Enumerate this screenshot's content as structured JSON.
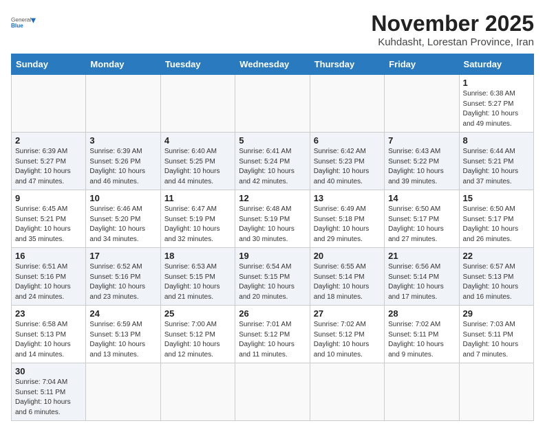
{
  "header": {
    "logo_line1": "General",
    "logo_line2": "Blue",
    "month_title": "November 2025",
    "location": "Kuhdasht, Lorestan Province, Iran"
  },
  "weekdays": [
    "Sunday",
    "Monday",
    "Tuesday",
    "Wednesday",
    "Thursday",
    "Friday",
    "Saturday"
  ],
  "weeks": [
    [
      {
        "day": "",
        "info": ""
      },
      {
        "day": "",
        "info": ""
      },
      {
        "day": "",
        "info": ""
      },
      {
        "day": "",
        "info": ""
      },
      {
        "day": "",
        "info": ""
      },
      {
        "day": "",
        "info": ""
      },
      {
        "day": "1",
        "info": "Sunrise: 6:38 AM\nSunset: 5:27 PM\nDaylight: 10 hours\nand 49 minutes."
      }
    ],
    [
      {
        "day": "2",
        "info": "Sunrise: 6:39 AM\nSunset: 5:27 PM\nDaylight: 10 hours\nand 47 minutes."
      },
      {
        "day": "3",
        "info": "Sunrise: 6:39 AM\nSunset: 5:26 PM\nDaylight: 10 hours\nand 46 minutes."
      },
      {
        "day": "4",
        "info": "Sunrise: 6:40 AM\nSunset: 5:25 PM\nDaylight: 10 hours\nand 44 minutes."
      },
      {
        "day": "5",
        "info": "Sunrise: 6:41 AM\nSunset: 5:24 PM\nDaylight: 10 hours\nand 42 minutes."
      },
      {
        "day": "6",
        "info": "Sunrise: 6:42 AM\nSunset: 5:23 PM\nDaylight: 10 hours\nand 40 minutes."
      },
      {
        "day": "7",
        "info": "Sunrise: 6:43 AM\nSunset: 5:22 PM\nDaylight: 10 hours\nand 39 minutes."
      },
      {
        "day": "8",
        "info": "Sunrise: 6:44 AM\nSunset: 5:21 PM\nDaylight: 10 hours\nand 37 minutes."
      }
    ],
    [
      {
        "day": "9",
        "info": "Sunrise: 6:45 AM\nSunset: 5:21 PM\nDaylight: 10 hours\nand 35 minutes."
      },
      {
        "day": "10",
        "info": "Sunrise: 6:46 AM\nSunset: 5:20 PM\nDaylight: 10 hours\nand 34 minutes."
      },
      {
        "day": "11",
        "info": "Sunrise: 6:47 AM\nSunset: 5:19 PM\nDaylight: 10 hours\nand 32 minutes."
      },
      {
        "day": "12",
        "info": "Sunrise: 6:48 AM\nSunset: 5:19 PM\nDaylight: 10 hours\nand 30 minutes."
      },
      {
        "day": "13",
        "info": "Sunrise: 6:49 AM\nSunset: 5:18 PM\nDaylight: 10 hours\nand 29 minutes."
      },
      {
        "day": "14",
        "info": "Sunrise: 6:50 AM\nSunset: 5:17 PM\nDaylight: 10 hours\nand 27 minutes."
      },
      {
        "day": "15",
        "info": "Sunrise: 6:50 AM\nSunset: 5:17 PM\nDaylight: 10 hours\nand 26 minutes."
      }
    ],
    [
      {
        "day": "16",
        "info": "Sunrise: 6:51 AM\nSunset: 5:16 PM\nDaylight: 10 hours\nand 24 minutes."
      },
      {
        "day": "17",
        "info": "Sunrise: 6:52 AM\nSunset: 5:16 PM\nDaylight: 10 hours\nand 23 minutes."
      },
      {
        "day": "18",
        "info": "Sunrise: 6:53 AM\nSunset: 5:15 PM\nDaylight: 10 hours\nand 21 minutes."
      },
      {
        "day": "19",
        "info": "Sunrise: 6:54 AM\nSunset: 5:15 PM\nDaylight: 10 hours\nand 20 minutes."
      },
      {
        "day": "20",
        "info": "Sunrise: 6:55 AM\nSunset: 5:14 PM\nDaylight: 10 hours\nand 18 minutes."
      },
      {
        "day": "21",
        "info": "Sunrise: 6:56 AM\nSunset: 5:14 PM\nDaylight: 10 hours\nand 17 minutes."
      },
      {
        "day": "22",
        "info": "Sunrise: 6:57 AM\nSunset: 5:13 PM\nDaylight: 10 hours\nand 16 minutes."
      }
    ],
    [
      {
        "day": "23",
        "info": "Sunrise: 6:58 AM\nSunset: 5:13 PM\nDaylight: 10 hours\nand 14 minutes."
      },
      {
        "day": "24",
        "info": "Sunrise: 6:59 AM\nSunset: 5:13 PM\nDaylight: 10 hours\nand 13 minutes."
      },
      {
        "day": "25",
        "info": "Sunrise: 7:00 AM\nSunset: 5:12 PM\nDaylight: 10 hours\nand 12 minutes."
      },
      {
        "day": "26",
        "info": "Sunrise: 7:01 AM\nSunset: 5:12 PM\nDaylight: 10 hours\nand 11 minutes."
      },
      {
        "day": "27",
        "info": "Sunrise: 7:02 AM\nSunset: 5:12 PM\nDaylight: 10 hours\nand 10 minutes."
      },
      {
        "day": "28",
        "info": "Sunrise: 7:02 AM\nSunset: 5:11 PM\nDaylight: 10 hours\nand 9 minutes."
      },
      {
        "day": "29",
        "info": "Sunrise: 7:03 AM\nSunset: 5:11 PM\nDaylight: 10 hours\nand 7 minutes."
      }
    ],
    [
      {
        "day": "30",
        "info": "Sunrise: 7:04 AM\nSunset: 5:11 PM\nDaylight: 10 hours\nand 6 minutes."
      },
      {
        "day": "",
        "info": ""
      },
      {
        "day": "",
        "info": ""
      },
      {
        "day": "",
        "info": ""
      },
      {
        "day": "",
        "info": ""
      },
      {
        "day": "",
        "info": ""
      },
      {
        "day": "",
        "info": ""
      }
    ]
  ]
}
